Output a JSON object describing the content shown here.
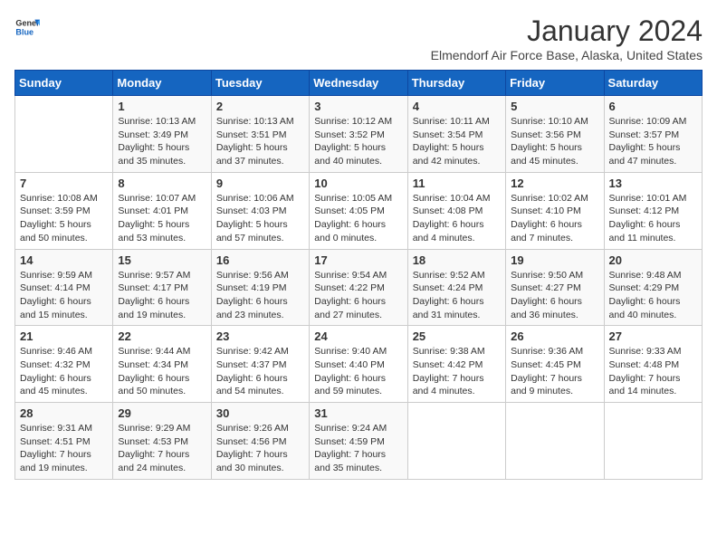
{
  "header": {
    "logo_line1": "General",
    "logo_line2": "Blue",
    "month_title": "January 2024",
    "location": "Elmendorf Air Force Base, Alaska, United States"
  },
  "days_of_week": [
    "Sunday",
    "Monday",
    "Tuesday",
    "Wednesday",
    "Thursday",
    "Friday",
    "Saturday"
  ],
  "weeks": [
    [
      {
        "day": "",
        "info": ""
      },
      {
        "day": "1",
        "info": "Sunrise: 10:13 AM\nSunset: 3:49 PM\nDaylight: 5 hours\nand 35 minutes."
      },
      {
        "day": "2",
        "info": "Sunrise: 10:13 AM\nSunset: 3:51 PM\nDaylight: 5 hours\nand 37 minutes."
      },
      {
        "day": "3",
        "info": "Sunrise: 10:12 AM\nSunset: 3:52 PM\nDaylight: 5 hours\nand 40 minutes."
      },
      {
        "day": "4",
        "info": "Sunrise: 10:11 AM\nSunset: 3:54 PM\nDaylight: 5 hours\nand 42 minutes."
      },
      {
        "day": "5",
        "info": "Sunrise: 10:10 AM\nSunset: 3:56 PM\nDaylight: 5 hours\nand 45 minutes."
      },
      {
        "day": "6",
        "info": "Sunrise: 10:09 AM\nSunset: 3:57 PM\nDaylight: 5 hours\nand 47 minutes."
      }
    ],
    [
      {
        "day": "7",
        "info": "Sunrise: 10:08 AM\nSunset: 3:59 PM\nDaylight: 5 hours\nand 50 minutes."
      },
      {
        "day": "8",
        "info": "Sunrise: 10:07 AM\nSunset: 4:01 PM\nDaylight: 5 hours\nand 53 minutes."
      },
      {
        "day": "9",
        "info": "Sunrise: 10:06 AM\nSunset: 4:03 PM\nDaylight: 5 hours\nand 57 minutes."
      },
      {
        "day": "10",
        "info": "Sunrise: 10:05 AM\nSunset: 4:05 PM\nDaylight: 6 hours\nand 0 minutes."
      },
      {
        "day": "11",
        "info": "Sunrise: 10:04 AM\nSunset: 4:08 PM\nDaylight: 6 hours\nand 4 minutes."
      },
      {
        "day": "12",
        "info": "Sunrise: 10:02 AM\nSunset: 4:10 PM\nDaylight: 6 hours\nand 7 minutes."
      },
      {
        "day": "13",
        "info": "Sunrise: 10:01 AM\nSunset: 4:12 PM\nDaylight: 6 hours\nand 11 minutes."
      }
    ],
    [
      {
        "day": "14",
        "info": "Sunrise: 9:59 AM\nSunset: 4:14 PM\nDaylight: 6 hours\nand 15 minutes."
      },
      {
        "day": "15",
        "info": "Sunrise: 9:57 AM\nSunset: 4:17 PM\nDaylight: 6 hours\nand 19 minutes."
      },
      {
        "day": "16",
        "info": "Sunrise: 9:56 AM\nSunset: 4:19 PM\nDaylight: 6 hours\nand 23 minutes."
      },
      {
        "day": "17",
        "info": "Sunrise: 9:54 AM\nSunset: 4:22 PM\nDaylight: 6 hours\nand 27 minutes."
      },
      {
        "day": "18",
        "info": "Sunrise: 9:52 AM\nSunset: 4:24 PM\nDaylight: 6 hours\nand 31 minutes."
      },
      {
        "day": "19",
        "info": "Sunrise: 9:50 AM\nSunset: 4:27 PM\nDaylight: 6 hours\nand 36 minutes."
      },
      {
        "day": "20",
        "info": "Sunrise: 9:48 AM\nSunset: 4:29 PM\nDaylight: 6 hours\nand 40 minutes."
      }
    ],
    [
      {
        "day": "21",
        "info": "Sunrise: 9:46 AM\nSunset: 4:32 PM\nDaylight: 6 hours\nand 45 minutes."
      },
      {
        "day": "22",
        "info": "Sunrise: 9:44 AM\nSunset: 4:34 PM\nDaylight: 6 hours\nand 50 minutes."
      },
      {
        "day": "23",
        "info": "Sunrise: 9:42 AM\nSunset: 4:37 PM\nDaylight: 6 hours\nand 54 minutes."
      },
      {
        "day": "24",
        "info": "Sunrise: 9:40 AM\nSunset: 4:40 PM\nDaylight: 6 hours\nand 59 minutes."
      },
      {
        "day": "25",
        "info": "Sunrise: 9:38 AM\nSunset: 4:42 PM\nDaylight: 7 hours\nand 4 minutes."
      },
      {
        "day": "26",
        "info": "Sunrise: 9:36 AM\nSunset: 4:45 PM\nDaylight: 7 hours\nand 9 minutes."
      },
      {
        "day": "27",
        "info": "Sunrise: 9:33 AM\nSunset: 4:48 PM\nDaylight: 7 hours\nand 14 minutes."
      }
    ],
    [
      {
        "day": "28",
        "info": "Sunrise: 9:31 AM\nSunset: 4:51 PM\nDaylight: 7 hours\nand 19 minutes."
      },
      {
        "day": "29",
        "info": "Sunrise: 9:29 AM\nSunset: 4:53 PM\nDaylight: 7 hours\nand 24 minutes."
      },
      {
        "day": "30",
        "info": "Sunrise: 9:26 AM\nSunset: 4:56 PM\nDaylight: 7 hours\nand 30 minutes."
      },
      {
        "day": "31",
        "info": "Sunrise: 9:24 AM\nSunset: 4:59 PM\nDaylight: 7 hours\nand 35 minutes."
      },
      {
        "day": "",
        "info": ""
      },
      {
        "day": "",
        "info": ""
      },
      {
        "day": "",
        "info": ""
      }
    ]
  ]
}
